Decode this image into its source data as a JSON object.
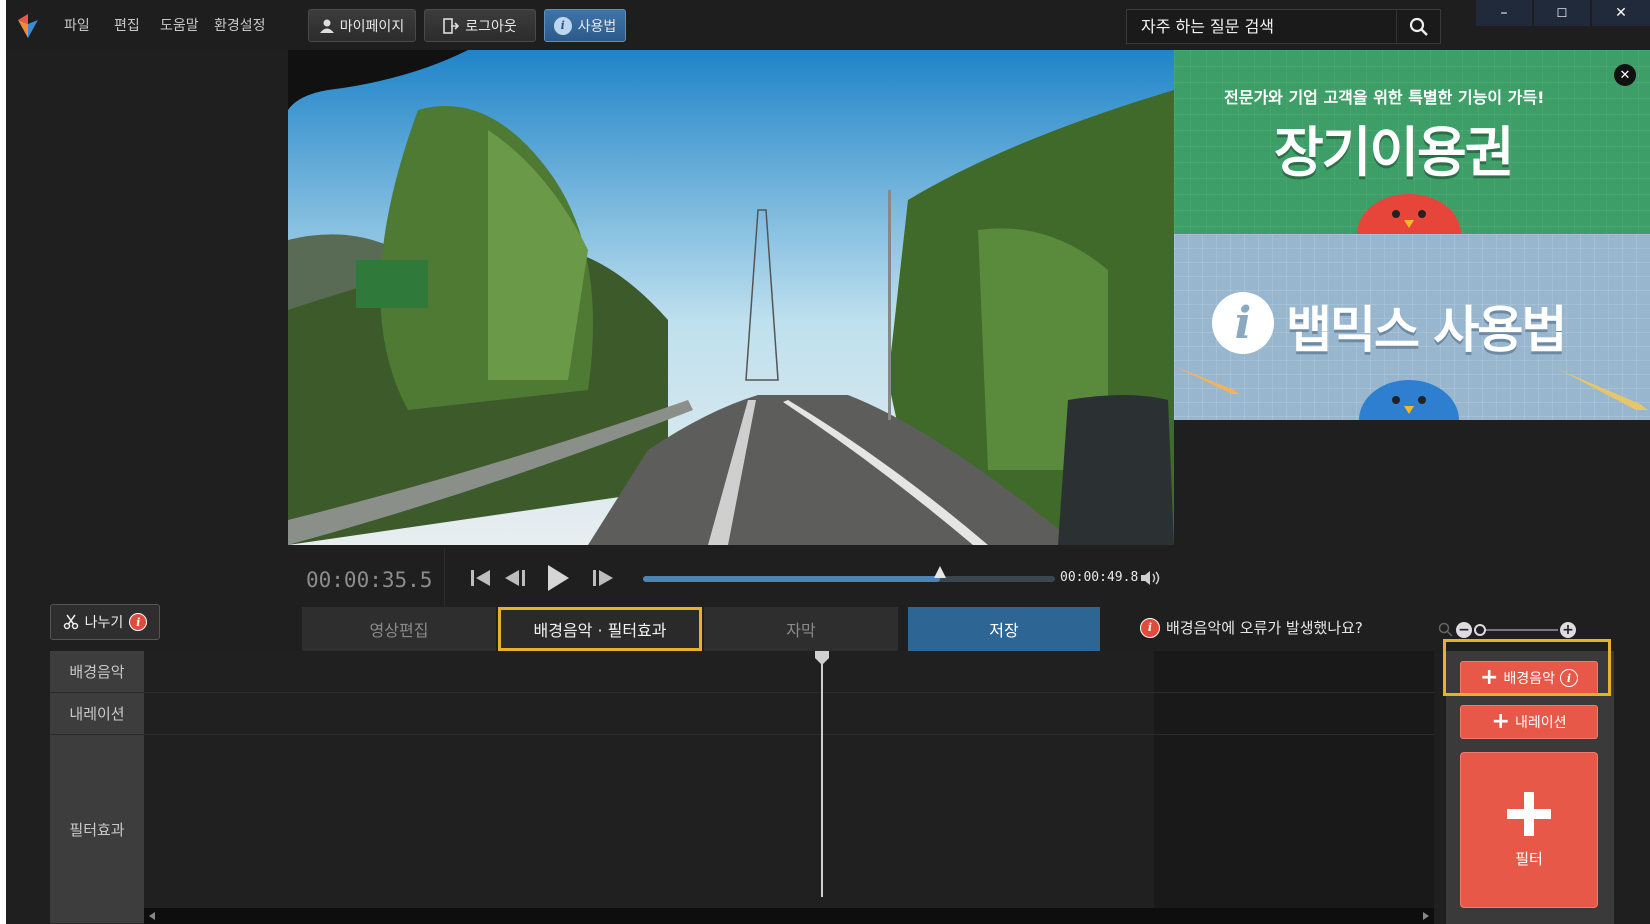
{
  "menu": [
    "파일",
    "편집",
    "도움말",
    "환경설정"
  ],
  "toolbar": {
    "mypage": "마이페이지",
    "logout": "로그아웃",
    "howto": "사용법"
  },
  "search": {
    "placeholder": "자주 하는 질문 검색"
  },
  "window": {
    "minimize": "–",
    "maximize": "☐",
    "close": "✕"
  },
  "ad": {
    "top_line": "전문가와 기업 고객을 위한 특별한 기능이 가득!",
    "top_title": "장기이용권",
    "bottom_title": "뱁믹스 사용법"
  },
  "player": {
    "current_time": "00:00:35.5",
    "duration": "00:00:49.8",
    "progress": 0.72
  },
  "split_button": {
    "label": "나누기"
  },
  "tabs": [
    "영상편집",
    "배경음악 · 필터효과",
    "자막",
    "저장"
  ],
  "active_tab": "배경음악 · 필터효과",
  "notice": "배경음악에 오류가 발생했나요?",
  "tracks": [
    "배경음악",
    "내레이션",
    "필터효과"
  ],
  "right_panel": {
    "bgm_button": "배경음악",
    "narration_button": "내레이션",
    "filter_button": "필터"
  },
  "colors": {
    "accent_red": "#e85848",
    "save_blue": "#2d6594",
    "highlight": "#e8b12a"
  }
}
